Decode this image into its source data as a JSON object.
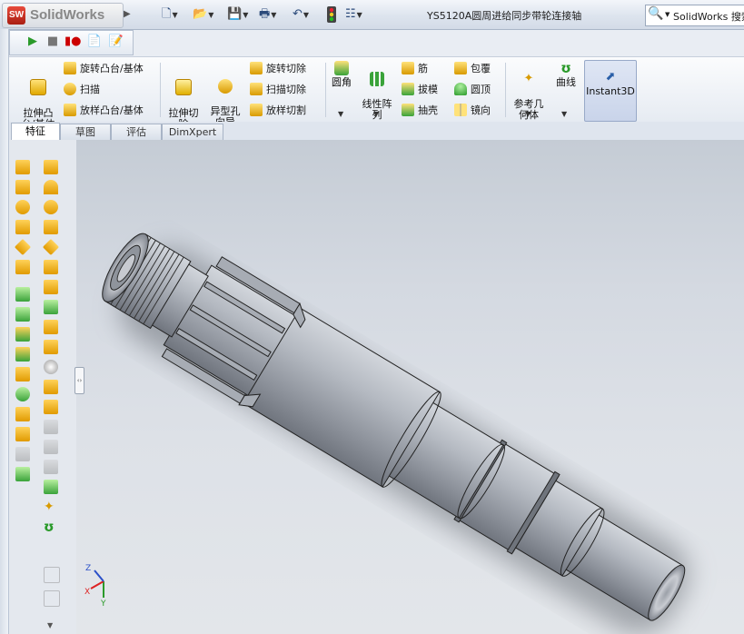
{
  "app": {
    "logo_text": "SolidWorks",
    "logo_badge": "SW",
    "document_title": "YS5120A圆周进给同步带轮连接轴",
    "search_label": "SolidWorks 搜索"
  },
  "quick_access": [
    {
      "icon": "new-document-icon"
    },
    {
      "icon": "open-folder-icon"
    },
    {
      "icon": "save-icon"
    },
    {
      "icon": "print-icon"
    },
    {
      "icon": "undo-icon"
    },
    {
      "icon": "rebuild-traffic-light-icon"
    },
    {
      "icon": "options-list-icon"
    }
  ],
  "macro_bar": [
    {
      "icon": "run-macro-icon"
    },
    {
      "icon": "stop-macro-icon"
    },
    {
      "icon": "record-macro-icon"
    },
    {
      "icon": "new-macro-icon"
    },
    {
      "icon": "edit-macro-icon"
    }
  ],
  "ribbon": {
    "extrude_boss": "拉伸凸\n台/基体",
    "revolve_boss": "旋转凸台/基体",
    "sweep": "扫描",
    "loft_boss": "放样凸台/基体",
    "extrude_cut": "拉伸切\n除",
    "hole_wizard": "异型孔\n向导",
    "revolve_cut": "旋转切除",
    "sweep_cut": "扫描切除",
    "loft_cut": "放样切割",
    "fillet": "圆角",
    "linear_pattern": "线性阵\n列",
    "rib": "筋",
    "draft": "拔模",
    "shell": "抽壳",
    "wrap": "包覆",
    "dome": "圆顶",
    "mirror": "镜向",
    "ref_geometry": "参考几\n何体",
    "curves": "曲线",
    "instant3d": "Instant3D"
  },
  "tabs": [
    {
      "label": "特征",
      "active": true
    },
    {
      "label": "草图",
      "active": false
    },
    {
      "label": "评估",
      "active": false
    },
    {
      "label": "DimXpert",
      "active": false
    }
  ],
  "triad": {
    "x": "X",
    "y": "Y",
    "z": "Z"
  },
  "colors": {
    "accent_blue": "#2a5fa8",
    "feature_yellow": "#e9b400",
    "feature_green": "#3aa33a",
    "part_gray": "#9aa0a8"
  }
}
